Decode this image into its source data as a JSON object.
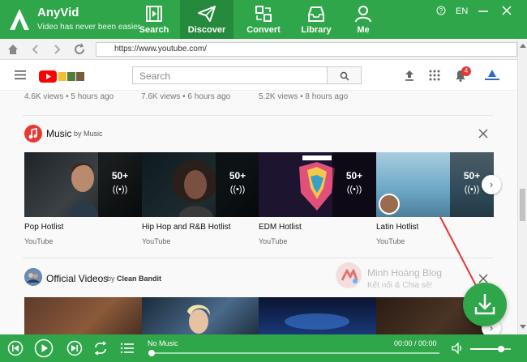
{
  "app": {
    "name": "AnyVid",
    "tagline": "Video has never been easier"
  },
  "nav": {
    "tabs": [
      {
        "label": "Search",
        "icon": "film-icon"
      },
      {
        "label": "Discover",
        "icon": "paper-plane-icon",
        "active": true
      },
      {
        "label": "Convert",
        "icon": "convert-icon"
      },
      {
        "label": "Library",
        "icon": "inbox-icon"
      },
      {
        "label": "Me",
        "icon": "user-icon"
      }
    ],
    "help": "?",
    "language": "EN"
  },
  "browser": {
    "url": "https://www.youtube.com/"
  },
  "youtube": {
    "search_placeholder": "Search",
    "notification_count": "4",
    "previous_row": [
      {
        "meta": "4.6K views • 5 hours ago"
      },
      {
        "meta": "7.6K views • 6 hours ago"
      },
      {
        "meta": "5.2K views • 8 hours ago"
      }
    ],
    "shelves": [
      {
        "title": "Music",
        "by": "by Music",
        "cards": [
          {
            "title": "Pop Hotlist",
            "channel": "YouTube",
            "count": "50+"
          },
          {
            "title": "Hip Hop and R&B Hotlist",
            "channel": "YouTube",
            "count": "50+"
          },
          {
            "title": "EDM Hotlist",
            "channel": "YouTube",
            "count": "50+"
          },
          {
            "title": "Latin Hotlist",
            "channel": "YouTube",
            "count": "50+"
          }
        ]
      },
      {
        "title": "Official Videos",
        "by": "by",
        "channel": "Clean Bandit"
      }
    ]
  },
  "watermark": {
    "title": "Minh Hoàng Blog",
    "subtitle": "Kết nối & Chia sẻ!"
  },
  "player": {
    "now_playing": "No Music",
    "time": "00:00 / 00:00",
    "progress": 0,
    "volume": 0.75
  },
  "colors": {
    "brand": "#2fa64a",
    "brand_dark": "#258a3c",
    "youtube_red": "#ff0000",
    "arrow": "#e53935"
  }
}
